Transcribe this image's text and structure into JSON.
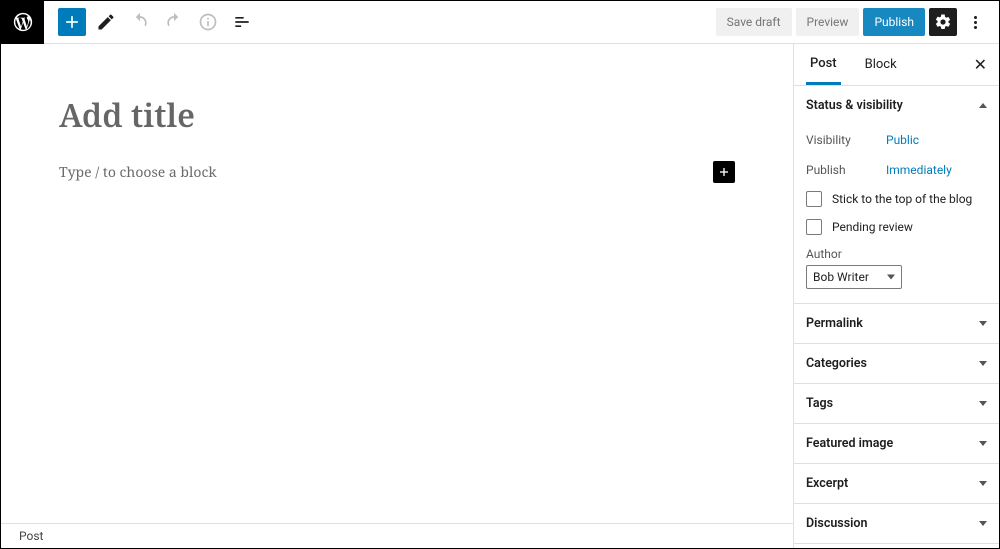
{
  "toolbar": {
    "save_draft": "Save draft",
    "preview": "Preview",
    "publish": "Publish"
  },
  "editor": {
    "title_placeholder": "Add title",
    "block_placeholder": "Type / to choose a block"
  },
  "breadcrumb": "Post",
  "sidebar": {
    "tabs": {
      "post": "Post",
      "block": "Block"
    },
    "status": {
      "heading": "Status & visibility",
      "visibility_label": "Visibility",
      "visibility_value": "Public",
      "publish_label": "Publish",
      "publish_value": "Immediately",
      "stick_label": "Stick to the top of the blog",
      "pending_label": "Pending review",
      "author_label": "Author",
      "author_value": "Bob Writer"
    },
    "panels": {
      "permalink": "Permalink",
      "categories": "Categories",
      "tags": "Tags",
      "featured": "Featured image",
      "excerpt": "Excerpt",
      "discussion": "Discussion"
    }
  }
}
